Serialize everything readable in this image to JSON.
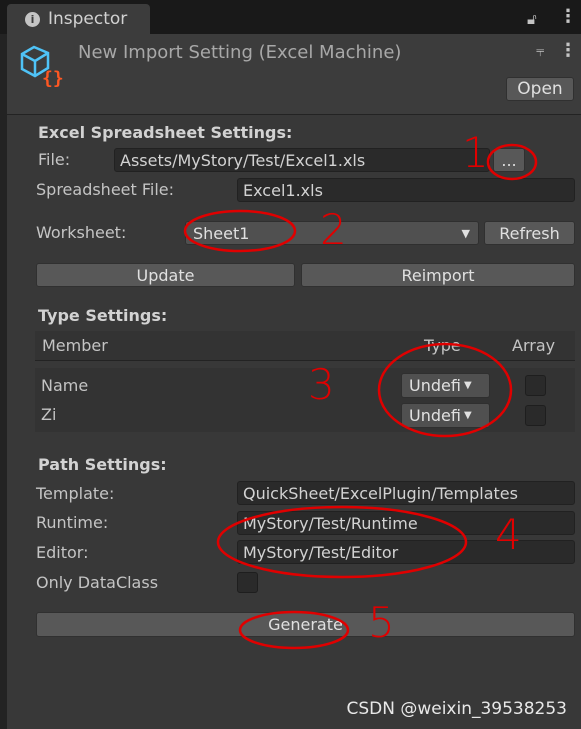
{
  "tab": {
    "title": "Inspector",
    "info_icon": "info-icon",
    "lock_icon": "lock-icon",
    "menu_icon": "kebab-menu-icon"
  },
  "header": {
    "title": "New Import Setting (Excel Machine)",
    "asset_icon": "excel-machine-asset-icon",
    "settings_icon": "sliders-icon",
    "menu_icon": "kebab-menu-icon",
    "open_label": "Open"
  },
  "excel": {
    "heading": "Excel Spreadsheet Settings:",
    "file_label": "File:",
    "file_value": "Assets/MyStory/Test/Excel1.xls",
    "browse_label": "...",
    "spreadsheet_label": "Spreadsheet File:",
    "spreadsheet_value": "Excel1.xls",
    "worksheet_label": "Worksheet:",
    "worksheet_value": "Sheet1",
    "refresh_label": "Refresh",
    "update_label": "Update",
    "reimport_label": "Reimport"
  },
  "type": {
    "heading": "Type Settings:",
    "columns": [
      "Member",
      "Type",
      "Array"
    ],
    "rows": [
      {
        "member": "Name",
        "type": "Undefi",
        "array": false
      },
      {
        "member": "Zi",
        "type": "Undefi",
        "array": false
      }
    ]
  },
  "path": {
    "heading": "Path Settings:",
    "template_label": "Template:",
    "template_value": "QuickSheet/ExcelPlugin/Templates",
    "runtime_label": "Runtime:",
    "runtime_value": "MyStory/Test/Runtime",
    "editor_label": "Editor:",
    "editor_value": "MyStory/Test/Editor",
    "dataclass_label": "Only DataClass",
    "dataclass_checked": false,
    "generate_label": "Generate"
  },
  "annotations": [
    "1",
    "2",
    "3",
    "4",
    "5"
  ],
  "watermark": "CSDN @weixin_39538253",
  "colors": {
    "annotation": "#e00000",
    "icon_blue": "#4fc3f7",
    "icon_orange": "#ff5722"
  }
}
